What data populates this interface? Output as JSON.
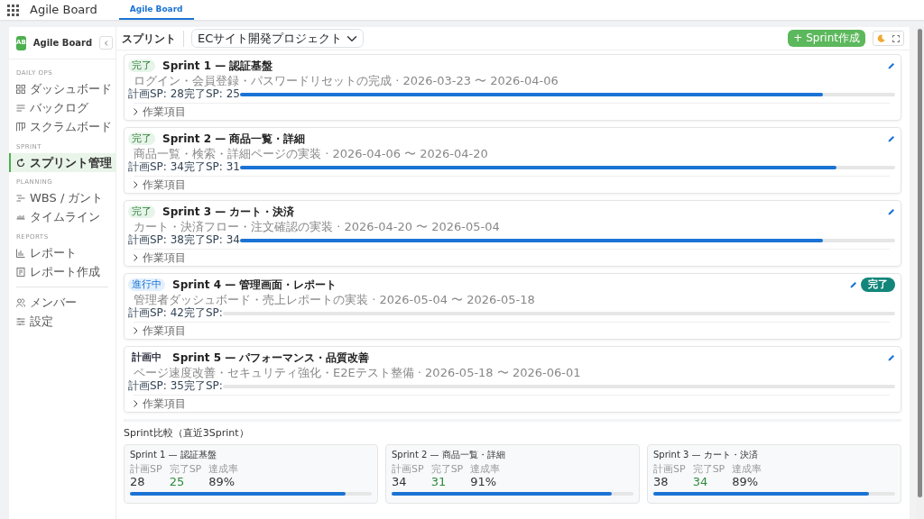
{
  "app": {
    "title": "Agile Board",
    "tabs": [
      {
        "label": "Agile Board",
        "selected": true
      }
    ]
  },
  "sidebar": {
    "brand_initials": "AB",
    "brand": "Agile Board",
    "sections": [
      {
        "label": "DAILY OPS",
        "items": [
          {
            "label": "ダッシュボード",
            "selected": false
          },
          {
            "label": "バックログ",
            "selected": false
          },
          {
            "label": "スクラムボード",
            "selected": false
          }
        ]
      },
      {
        "label": "SPRINT",
        "items": [
          {
            "label": "スプリント管理",
            "selected": true
          }
        ]
      },
      {
        "label": "PLANNING",
        "items": [
          {
            "label": "WBS / ガント",
            "selected": false
          },
          {
            "label": "タイムライン",
            "selected": false
          }
        ]
      },
      {
        "label": "REPORTS",
        "items": [
          {
            "label": "レポート",
            "selected": false
          },
          {
            "label": "レポート作成",
            "selected": false
          }
        ]
      },
      {
        "items": [
          {
            "label": "メンバー",
            "selected": false
          },
          {
            "label": "設定",
            "selected": false
          }
        ]
      }
    ]
  },
  "header": {
    "title": "スプリント",
    "project": "ECサイト開発プロジェクト",
    "create_button": "+ Sprint作成"
  },
  "sprints": [
    {
      "kind": "done",
      "status": "完了",
      "title": "Sprint 1 — 認証基盤",
      "details": "ログイン・会員登録・パスワードリセットの完成 · 2026-03-23 〜 2026-04-06",
      "sp": "計画SP: 28完了SP: 25",
      "level": 0.89,
      "toggle": "作業項目"
    },
    {
      "kind": "done",
      "status": "完了",
      "title": "Sprint 2 — 商品一覧・詳細",
      "details": "商品一覧・検索・詳細ページの実装 · 2026-04-06 〜 2026-04-20",
      "sp": "計画SP: 34完了SP: 31",
      "level": 0.91,
      "toggle": "作業項目"
    },
    {
      "kind": "done",
      "status": "完了",
      "title": "Sprint 3 — カート・決済",
      "details": "カート・決済フロー・注文確認の実装 · 2026-04-20 〜 2026-05-04",
      "sp": "計画SP: 38完了SP: 34",
      "level": 0.89,
      "toggle": "作業項目"
    },
    {
      "kind": "active",
      "status": "進行中",
      "title": "Sprint 4 — 管理画面・レポート",
      "details": "管理者ダッシュボード・売上レポートの実装 · 2026-05-04 〜 2026-05-18",
      "sp": "計画SP: 42完了SP:",
      "level": 0,
      "toggle": "作業項目",
      "complete_button": "完了"
    },
    {
      "kind": "planned",
      "status": "計画中",
      "title": "Sprint 5 — パフォーマンス・品質改善",
      "details": "ページ速度改善・セキュリティ強化・E2Eテスト整備 · 2026-05-18 〜 2026-06-01",
      "sp": "計画SP: 35完了SP:",
      "level": 0,
      "toggle": "作業項目"
    }
  ],
  "comparison": {
    "title": "Sprint比較（直近3Sprint）",
    "cards": [
      {
        "title": "Sprint 1 — 認証基盤",
        "stats": [
          {
            "label": "計画SP",
            "value": "28"
          },
          {
            "label": "完了SP",
            "value": "25"
          },
          {
            "label": "達成率",
            "value": "89%"
          }
        ],
        "level": 0.89
      },
      {
        "title": "Sprint 2 — 商品一覧・詳細",
        "stats": [
          {
            "label": "計画SP",
            "value": "34"
          },
          {
            "label": "完了SP",
            "value": "31"
          },
          {
            "label": "達成率",
            "value": "91%"
          }
        ],
        "level": 0.91
      },
      {
        "title": "Sprint 3 — カート・決済",
        "stats": [
          {
            "label": "計画SP",
            "value": "38"
          },
          {
            "label": "完了SP",
            "value": "34"
          },
          {
            "label": "達成率",
            "value": "89%"
          }
        ],
        "level": 0.89
      }
    ]
  }
}
